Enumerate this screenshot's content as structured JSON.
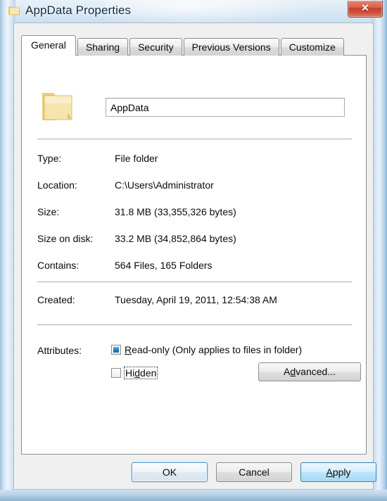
{
  "window": {
    "title": "AppData Properties",
    "icon": "folder-icon",
    "close_label": "✕"
  },
  "tabs": [
    {
      "label": "General",
      "active": true
    },
    {
      "label": "Sharing",
      "active": false
    },
    {
      "label": "Security",
      "active": false
    },
    {
      "label": "Previous Versions",
      "active": false
    },
    {
      "label": "Customize",
      "active": false
    }
  ],
  "general": {
    "name_value": "AppData",
    "name_placeholder": "",
    "properties": [
      {
        "label": "Type:",
        "value": "File folder"
      },
      {
        "label": "Location:",
        "value": "C:\\Users\\Administrator"
      },
      {
        "label": "Size:",
        "value": "31.8 MB (33,355,326 bytes)"
      },
      {
        "label": "Size on disk:",
        "value": "33.2 MB (34,852,864 bytes)"
      },
      {
        "label": "Contains:",
        "value": "564 Files, 165 Folders"
      }
    ],
    "created": {
      "label": "Created:",
      "value": "Tuesday, April 19, 2011, 12:54:38 AM"
    },
    "attributes": {
      "label": "Attributes:",
      "readonly": {
        "mnemonic": "R",
        "text": "ead-only (Only applies to files in folder)",
        "state": "indeterminate"
      },
      "hidden": {
        "prefix": "Hi",
        "mnemonic": "d",
        "suffix": "den",
        "state": "unchecked",
        "focused": true
      },
      "advanced_prefix": "A",
      "advanced_mnemonic": "d",
      "advanced_suffix": "vanced..."
    }
  },
  "buttons": {
    "ok": "OK",
    "cancel": "Cancel",
    "apply_prefix": "",
    "apply_mnemonic": "A",
    "apply_suffix": "pply"
  },
  "colors": {
    "accent_blue": "#3c7fb1",
    "close_red": "#c23f2c",
    "checkbox_fill": "#1f7fc4",
    "folder_yellow": "#f5dfa0",
    "frame_glass": "#cfe1f0"
  }
}
